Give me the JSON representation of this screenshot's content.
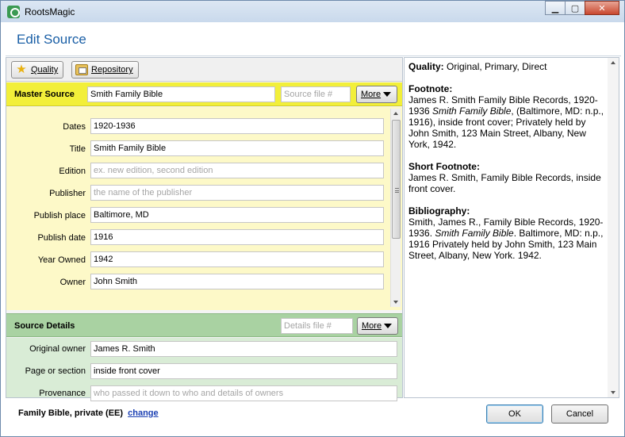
{
  "window": {
    "title": "RootsMagic",
    "minimize": "▁",
    "maximize": "▢",
    "close": "✕"
  },
  "dialog": {
    "title": "Edit Source"
  },
  "toolbar": {
    "quality_label": "Quality",
    "repository_label": "Repository"
  },
  "master": {
    "header": "Master Source",
    "name_value": "Smith Family Bible",
    "source_file_placeholder": "Source file #",
    "more_label": "More",
    "fields": [
      {
        "label": "Dates",
        "value": "1920-1936",
        "placeholder": ""
      },
      {
        "label": "Title",
        "value": "Smith Family Bible",
        "placeholder": ""
      },
      {
        "label": "Edition",
        "value": "",
        "placeholder": "ex. new edition, second edition"
      },
      {
        "label": "Publisher",
        "value": "",
        "placeholder": "the name of the publisher"
      },
      {
        "label": "Publish place",
        "value": "Baltimore, MD",
        "placeholder": ""
      },
      {
        "label": "Publish date",
        "value": "1916",
        "placeholder": ""
      },
      {
        "label": "Year Owned",
        "value": "1942",
        "placeholder": ""
      },
      {
        "label": "Owner",
        "value": "John Smith",
        "placeholder": ""
      }
    ]
  },
  "details": {
    "header": "Source Details",
    "details_file_placeholder": "Details file #",
    "more_label": "More",
    "fields": [
      {
        "label": "Original owner",
        "value": "James R. Smith",
        "placeholder": ""
      },
      {
        "label": "Page or section",
        "value": "inside front cover",
        "placeholder": ""
      },
      {
        "label": "Provenance",
        "value": "",
        "placeholder": "who passed it down to who and details of owners"
      }
    ]
  },
  "preview": {
    "quality_label": "Quality:",
    "quality_value": "Original, Primary, Direct",
    "footnote_label": "Footnote:",
    "footnote_pre": "James R. Smith Family Bible Records, 1920-1936 ",
    "footnote_italic": "Smith Family Bible",
    "footnote_post": ", (Baltimore, MD: n.p., 1916), inside front cover; Privately held by John Smith, 123 Main Street, Albany, New York, 1942.",
    "short_label": "Short Footnote:",
    "short_text": "James R. Smith, Family Bible Records, inside front cover.",
    "bib_label": "Bibliography:",
    "bib_pre": "Smith, James R., Family Bible Records, 1920-1936. ",
    "bib_italic": "Smith Family Bible",
    "bib_post": ". Baltimore, MD: n.p., 1916 Privately held by John Smith, 123 Main Street, Albany, New York. 1942."
  },
  "footer": {
    "template_text": "Family Bible, private (EE)",
    "change_link": "change",
    "ok_label": "OK",
    "cancel_label": "Cancel"
  }
}
